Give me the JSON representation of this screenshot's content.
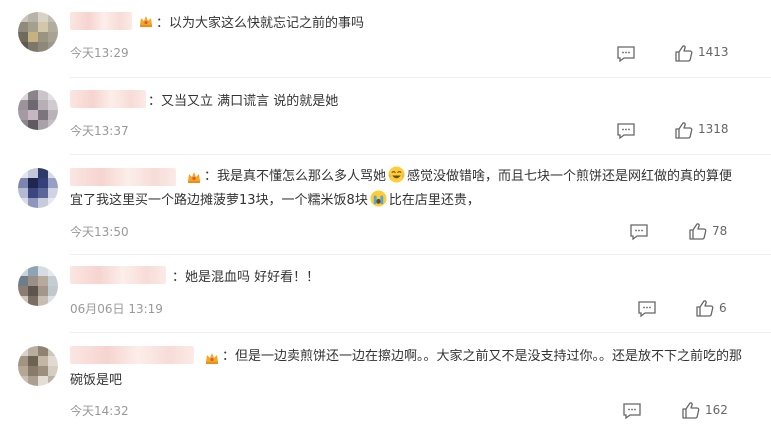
{
  "comments": [
    {
      "text": "：以为大家这么快就忘记之前的事吗",
      "time": "今天13:29",
      "likes": "1413"
    },
    {
      "text": "：又当又立 满口谎言 说的就是她",
      "time": "今天13:37",
      "likes": "1318"
    },
    {
      "text_a": "：我是真不懂怎么那么多人骂她",
      "text_b": "感觉没做错啥，而且七块一个煎饼还是网红做的真的算便宜了我这里买一个路边摊菠萝13块，一个糯米饭8块",
      "text_c": "比在店里还贵，",
      "time": "今天13:50",
      "likes": "78"
    },
    {
      "text": "：她是混血吗 好好看！！",
      "time": "06月06日 13:19",
      "likes": "6"
    },
    {
      "text": "：但是一边卖煎饼还一边在擦边啊。。大家之前又不是没支持过你。。还是放不下之前吃的那碗饭是吧",
      "time": "今天14:32",
      "likes": "162"
    }
  ],
  "icons": {
    "vip": "crown-icon",
    "reply": "comment-icon",
    "like": "thumbs-up-icon",
    "emoji_laugh": "laugh-tears-emoji",
    "emoji_cry": "crying-emoji"
  },
  "colors": {
    "text": "#333333",
    "meta": "#999999",
    "crown": "#f5a623"
  }
}
